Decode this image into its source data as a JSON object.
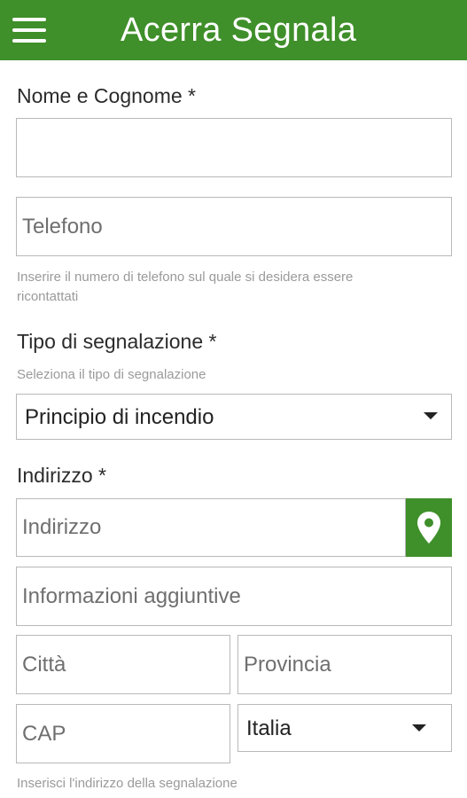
{
  "appbar": {
    "title": "Acerra Segnala",
    "menu_icon": "hamburger-menu-icon",
    "color": "#3f8f2a"
  },
  "form": {
    "name": {
      "label": "Nome e Cognome *",
      "value": "",
      "placeholder": ""
    },
    "phone": {
      "placeholder": "Telefono",
      "hint_line1": "Inserire il numero di telefono sul quale si desidera essere",
      "hint_line2": "ricontattati"
    },
    "report_type": {
      "label": "Tipo di segnalazione *",
      "hint": "Seleziona il tipo di segnalazione",
      "selected": "Principio di incendio"
    },
    "address": {
      "label": "Indirizzo *",
      "placeholder": "Indirizzo",
      "geo_icon": "map-marker-icon",
      "extra_placeholder": "Informazioni aggiuntive",
      "city_placeholder": "Città",
      "province_placeholder": "Provincia",
      "cap_placeholder": "CAP",
      "country_selected": "Italia",
      "hint": "Inserisci l'indirizzo della segnalazione"
    }
  }
}
